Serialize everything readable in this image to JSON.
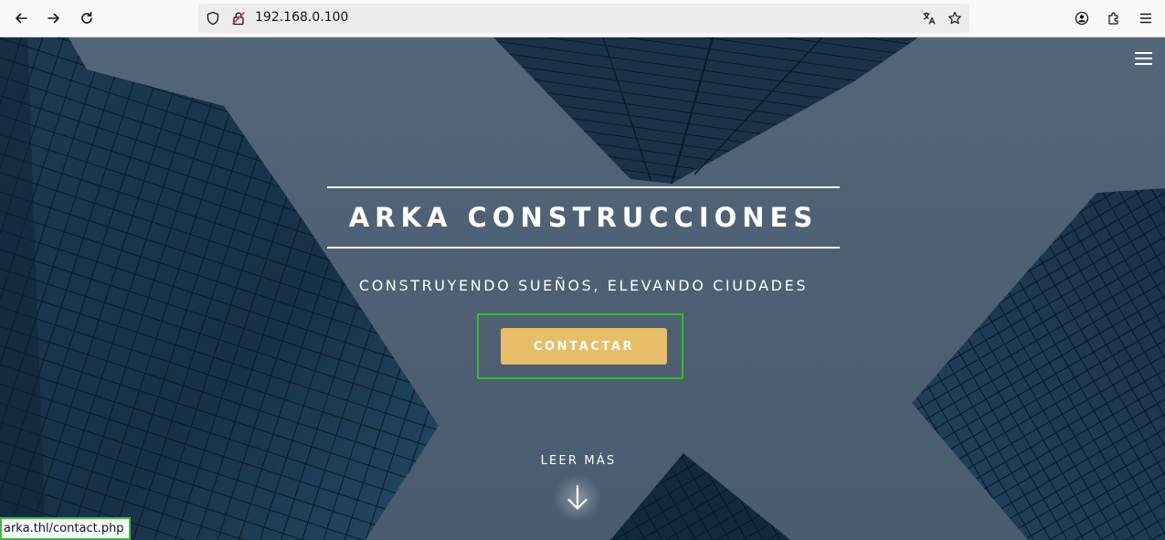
{
  "browser": {
    "url": "192.168.0.100",
    "icons": {
      "back": "back-arrow-icon",
      "forward": "forward-arrow-icon",
      "reload": "reload-icon",
      "shield": "tracking-shield-icon",
      "insecure": "insecure-lock-icon",
      "translate": "translate-icon",
      "bookmark": "star-icon",
      "account": "account-icon",
      "extensions": "puzzle-icon",
      "menu": "hamburger-menu-icon"
    }
  },
  "hero": {
    "title": "ARKA CONSTRUCCIONES",
    "subtitle": "CONSTRUYENDO SUEÑOS, ELEVANDO CIUDADES",
    "cta_label": "CONTACTAR",
    "read_more": "LEER MÁS"
  },
  "status_bar": {
    "link_url": "arka.thl/contact.php"
  },
  "colors": {
    "accent": "#e6be6a",
    "focus_outline": "#3cba3c",
    "sky": "#51637a",
    "glass": "#12263a"
  }
}
